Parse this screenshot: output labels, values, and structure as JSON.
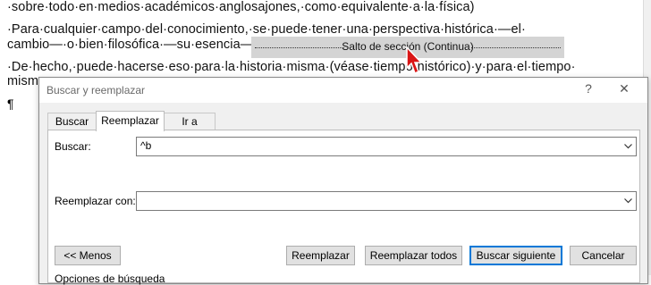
{
  "document": {
    "line1": "·sobre·todo·en·medios·académicos·anglosajones,·como·equivalente·a·la·física)",
    "line2": "·Para·cualquier·campo·del·conocimiento,·se·puede·tener·una·perspectiva·histórica·—el·",
    "line3": "cambio—·o·bien·filosófica·—su·esencia—.",
    "line4": "·De·hecho,·puede·hacerse·eso·para·la·historia·misma·(véase·tiempo·histórico)·y·para·el·tiempo·",
    "line5": "mism",
    "pilcrow": "¶",
    "section_break": "Salto de sección (Continua)"
  },
  "dialog": {
    "title": "Buscar y reemplazar",
    "help": "?",
    "close": "✕",
    "tabs": [
      {
        "label": "Buscar",
        "mnemonic_index": 1
      },
      {
        "label": "Reemplazar",
        "mnemonic_index": 2
      },
      {
        "label": "Ir a",
        "mnemonic_index": 0
      }
    ],
    "find_label": "Buscar:",
    "find_value": "^b",
    "replace_label": "Reemplazar con:",
    "replace_value": "",
    "buttons": {
      "less": "<< Menos",
      "replace": "Reemplazar",
      "replace_all": "Reemplazar todos",
      "find_next": "Buscar siguiente",
      "cancel": "Cancelar"
    },
    "options_label": "Opciones de búsqueda"
  }
}
